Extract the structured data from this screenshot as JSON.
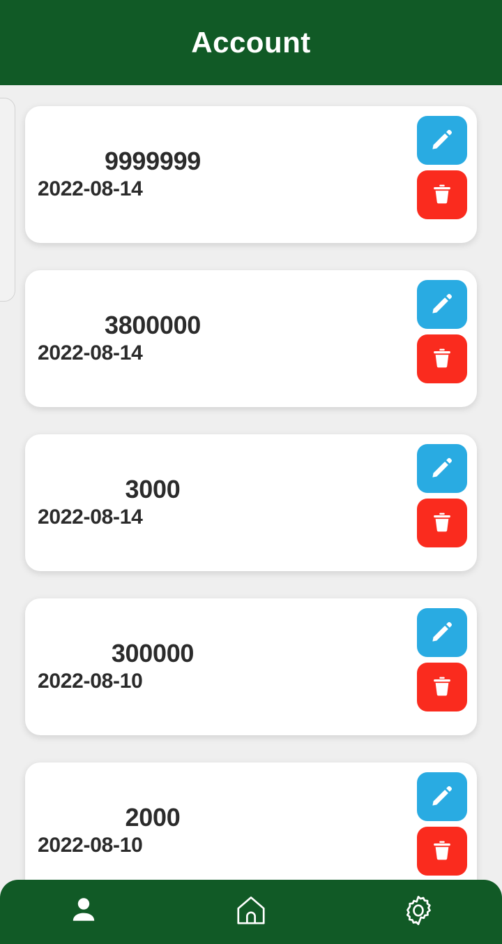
{
  "header": {
    "title": "Account",
    "background_color": "#115a26",
    "text_color": "#ffffff"
  },
  "colors": {
    "brand_green": "#115a26",
    "edit_blue": "#29abe2",
    "delete_red": "#fa2b1e",
    "page_background": "#efefef",
    "card_background": "#ffffff",
    "text_dark": "#2b2b2b"
  },
  "accounts": [
    {
      "amount": "9999999",
      "date": "2022-08-14",
      "edit_icon": "pencil-icon",
      "delete_icon": "trash-icon"
    },
    {
      "amount": "3800000",
      "date": "2022-08-14",
      "edit_icon": "pencil-icon",
      "delete_icon": "trash-icon"
    },
    {
      "amount": "3000",
      "date": "2022-08-14",
      "edit_icon": "pencil-icon",
      "delete_icon": "trash-icon"
    },
    {
      "amount": "300000",
      "date": "2022-08-10",
      "edit_icon": "pencil-icon",
      "delete_icon": "trash-icon"
    },
    {
      "amount": "2000",
      "date": "2022-08-10",
      "edit_icon": "pencil-icon",
      "delete_icon": "trash-icon"
    }
  ],
  "bottom_nav": {
    "items": [
      {
        "name": "account",
        "icon": "person-icon",
        "active": true
      },
      {
        "name": "home",
        "icon": "home-icon",
        "active": false
      },
      {
        "name": "settings",
        "icon": "gear-icon",
        "active": false
      }
    ]
  }
}
